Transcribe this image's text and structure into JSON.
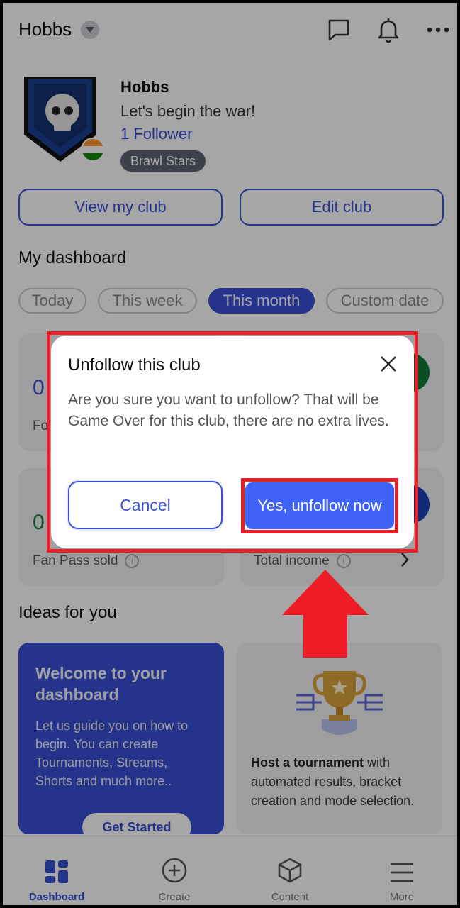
{
  "header": {
    "title": "Hobbs",
    "icons": [
      "chevron-down-icon",
      "chat-icon",
      "bell-icon",
      "more-icon"
    ]
  },
  "club": {
    "name": "Hobbs",
    "tagline": "Let's begin the war!",
    "followers": "1 Follower",
    "game": "Brawl Stars"
  },
  "actions": {
    "view_club": "View my club",
    "edit_club": "Edit club"
  },
  "dashboard": {
    "title": "My dashboard",
    "filters": [
      "Today",
      "This week",
      "This month",
      "Custom date"
    ],
    "active_filter": "This month",
    "stats": [
      {
        "value": "0",
        "label": "Fo"
      },
      {
        "value": "0",
        "label": "Fan Pass sold"
      },
      {
        "value": "",
        "label": "Total income"
      }
    ]
  },
  "ideas": {
    "title": "Ideas for you",
    "welcome_title": "Welcome to your dashboard",
    "welcome_desc": "Let us guide you on how to begin. You can create Tournaments, Streams, Shorts and much more..",
    "welcome_cta": "Get Started",
    "tournament_bold": "Host a tournament",
    "tournament_rest": " with automated results, bracket creation and mode selection."
  },
  "modal": {
    "title": "Unfollow this club",
    "body": "Are you sure you want to unfollow? That will be Game Over for this club, there are no extra lives.",
    "cancel": "Cancel",
    "confirm": "Yes, unfollow now"
  },
  "nav": {
    "items": [
      {
        "label": "Dashboard",
        "icon": "dashboard-icon"
      },
      {
        "label": "Create",
        "icon": "plus-circle-icon"
      },
      {
        "label": "Content",
        "icon": "box-icon"
      },
      {
        "label": "More",
        "icon": "menu-icon"
      }
    ]
  },
  "colors": {
    "accent": "#3b4fd6",
    "confirm": "#3f63f7",
    "highlight": "#e8202a"
  }
}
